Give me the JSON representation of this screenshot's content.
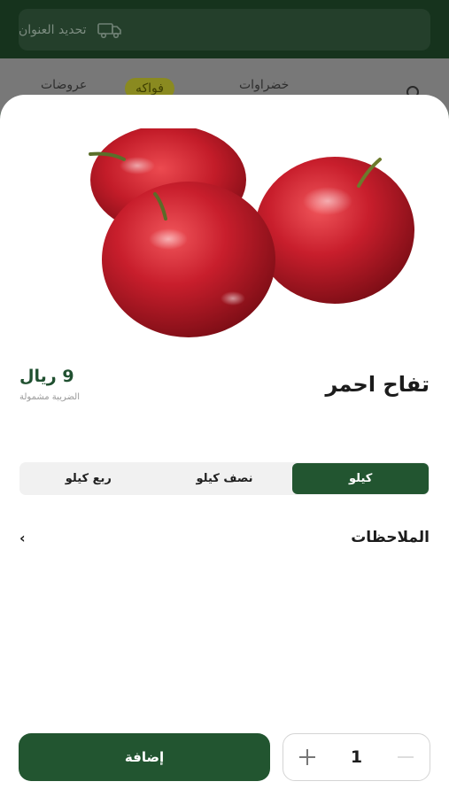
{
  "background": {
    "address_label": "تحديد العنوان",
    "address_icon": "delivery-truck-icon",
    "tabs": [
      {
        "label": "عروضات"
      },
      {
        "label": "فواكه"
      },
      {
        "label": "خضراوات"
      }
    ],
    "search_icon": "search-icon"
  },
  "product": {
    "name": "تفاح احمر",
    "price": "9 ريال",
    "tax_note": "الضريبة مشمولة",
    "image": "red-apples-image"
  },
  "units": {
    "options": [
      {
        "label": "كيلو",
        "selected": true
      },
      {
        "label": "نصف كيلو",
        "selected": false
      },
      {
        "label": "ربع كيلو",
        "selected": false
      }
    ]
  },
  "notes": {
    "label": "الملاحظات",
    "chevron": "›"
  },
  "actions": {
    "add_label": "إضافة",
    "quantity": "1"
  },
  "colors": {
    "primary": "#225530",
    "header_bg": "#16331d",
    "highlight_tab": "#8a8a20"
  }
}
